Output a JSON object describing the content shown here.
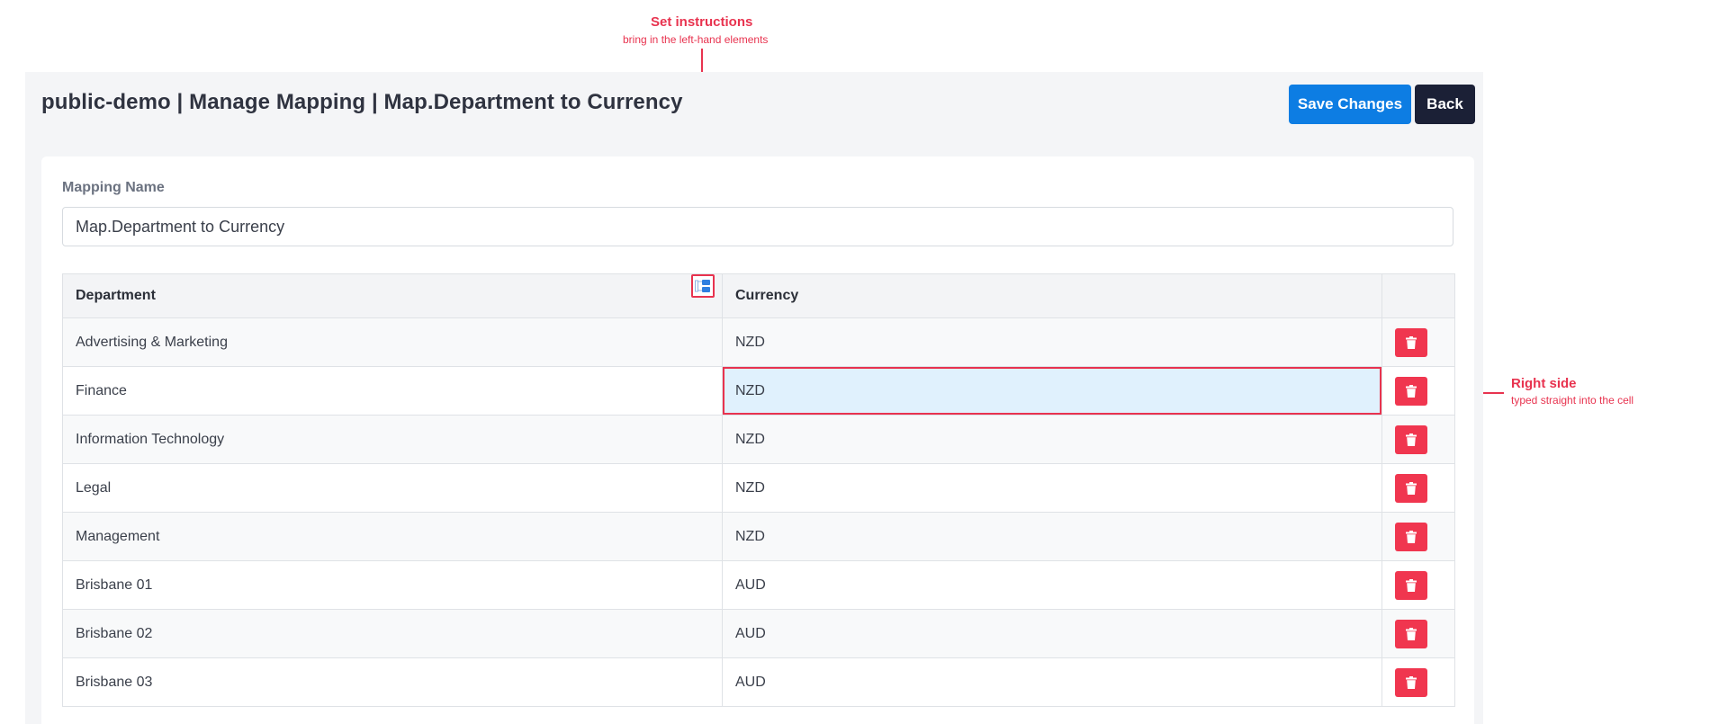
{
  "annotations": {
    "top": {
      "title": "Set instructions",
      "subtitle": "bring in the left-hand elements"
    },
    "right": {
      "title": "Right side",
      "subtitle": "typed straight into the cell"
    }
  },
  "header": {
    "title": "public-demo | Manage Mapping | Map.Department to Currency",
    "save_label": "Save Changes",
    "back_label": "Back"
  },
  "form": {
    "mapping_name_label": "Mapping Name",
    "mapping_name_value": "Map.Department to Currency"
  },
  "table": {
    "columns": [
      "Department",
      "Currency"
    ],
    "rows": [
      {
        "department": "Advertising & Marketing",
        "currency": "NZD"
      },
      {
        "department": "Finance",
        "currency": "NZD"
      },
      {
        "department": "Information Technology",
        "currency": "NZD"
      },
      {
        "department": "Legal",
        "currency": "NZD"
      },
      {
        "department": "Management",
        "currency": "NZD"
      },
      {
        "department": "Brisbane 01",
        "currency": "AUD"
      },
      {
        "department": "Brisbane 02",
        "currency": "AUD"
      },
      {
        "department": "Brisbane 03",
        "currency": "AUD"
      }
    ]
  },
  "colors": {
    "primary": "#0d7de3",
    "dark": "#1b2036",
    "danger": "#f0364f",
    "annotation": "#e8334f",
    "selected_cell": "#e0f1fd"
  },
  "icons": {
    "header_map": "map-left-elements-icon",
    "row_delete": "trash-icon"
  }
}
